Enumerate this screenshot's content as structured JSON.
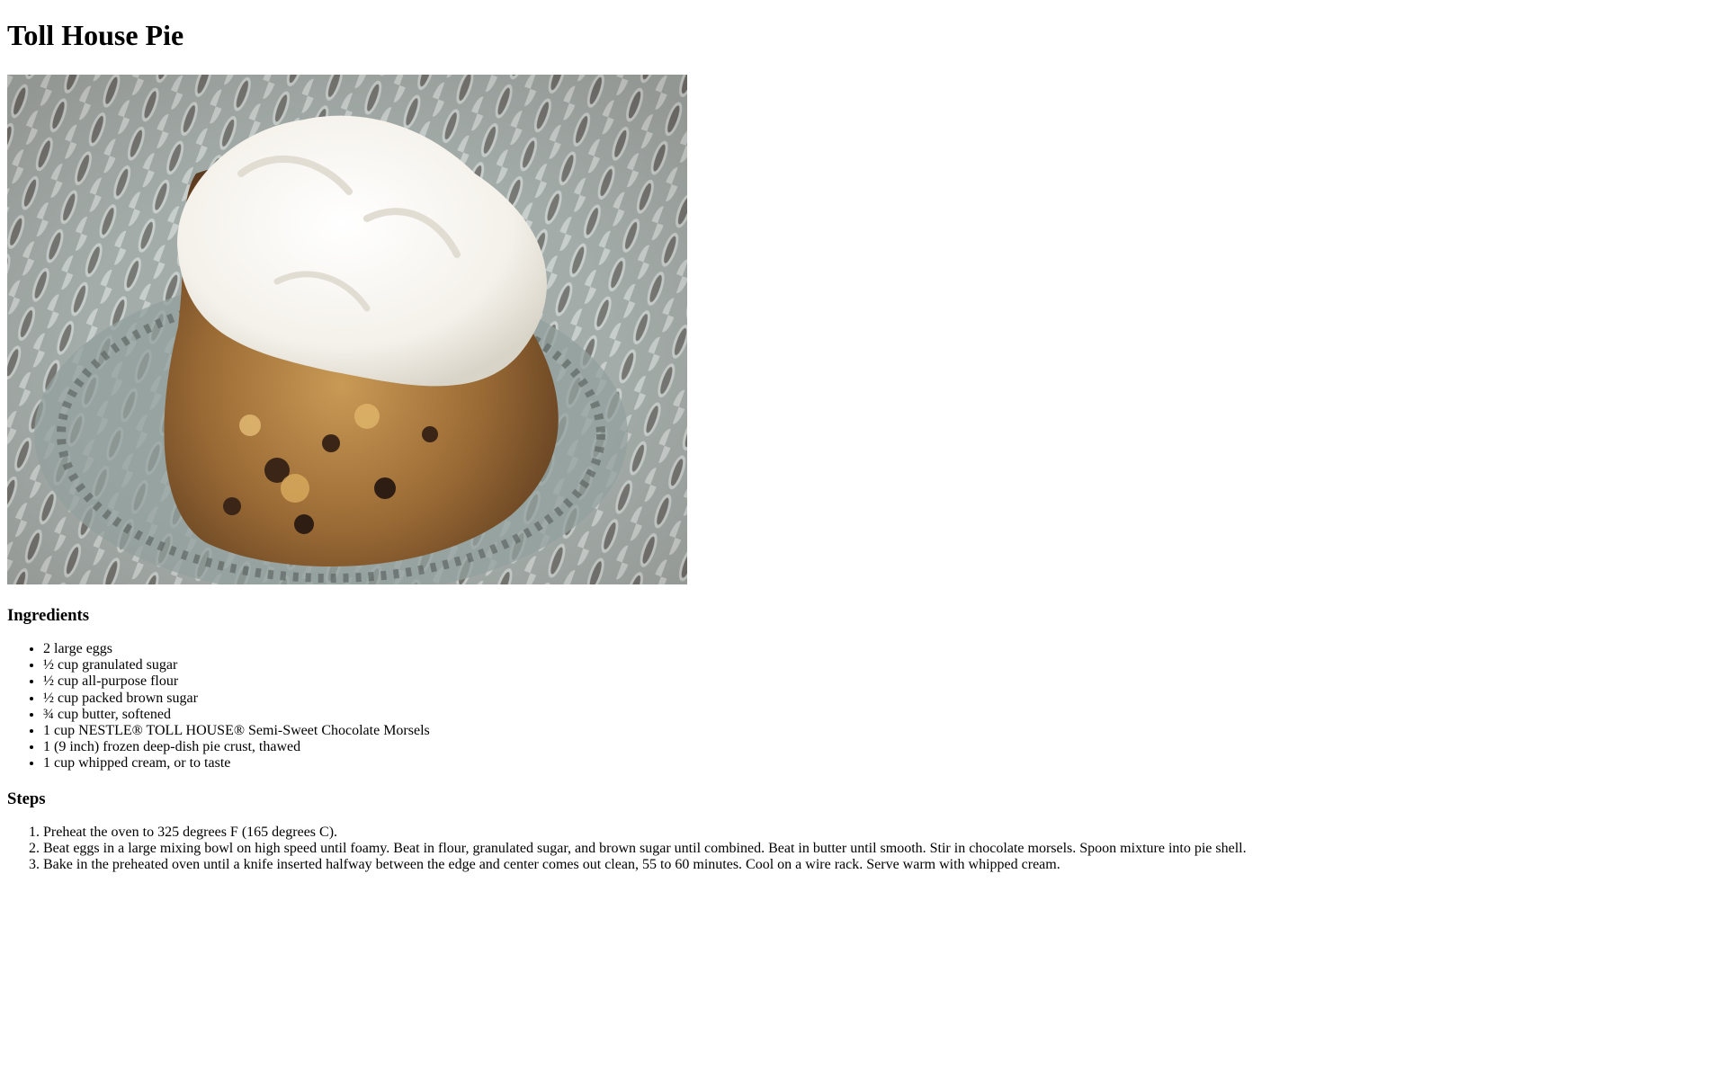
{
  "recipe": {
    "title": "Toll House Pie",
    "image_alt": "Slice of Toll House pie topped with whipped cream on a patterned plate",
    "ingredients_heading": "Ingredients",
    "ingredients": [
      "2 large eggs",
      "½ cup granulated sugar",
      "½ cup all-purpose flour",
      "½ cup packed brown sugar",
      "¾ cup butter, softened",
      "1 cup NESTLE® TOLL HOUSE® Semi-Sweet Chocolate Morsels",
      "1 (9 inch) frozen deep-dish pie crust, thawed",
      "1 cup whipped cream, or to taste"
    ],
    "steps_heading": "Steps",
    "steps": [
      "Preheat the oven to 325 degrees F (165 degrees C).",
      "Beat eggs in a large mixing bowl on high speed until foamy. Beat in flour, granulated sugar, and brown sugar until combined. Beat in butter until smooth. Stir in chocolate morsels. Spoon mixture into pie shell.",
      "Bake in the preheated oven until a knife inserted halfway between the edge and center comes out clean, 55 to 60 minutes. Cool on a wire rack. Serve warm with whipped cream."
    ]
  }
}
